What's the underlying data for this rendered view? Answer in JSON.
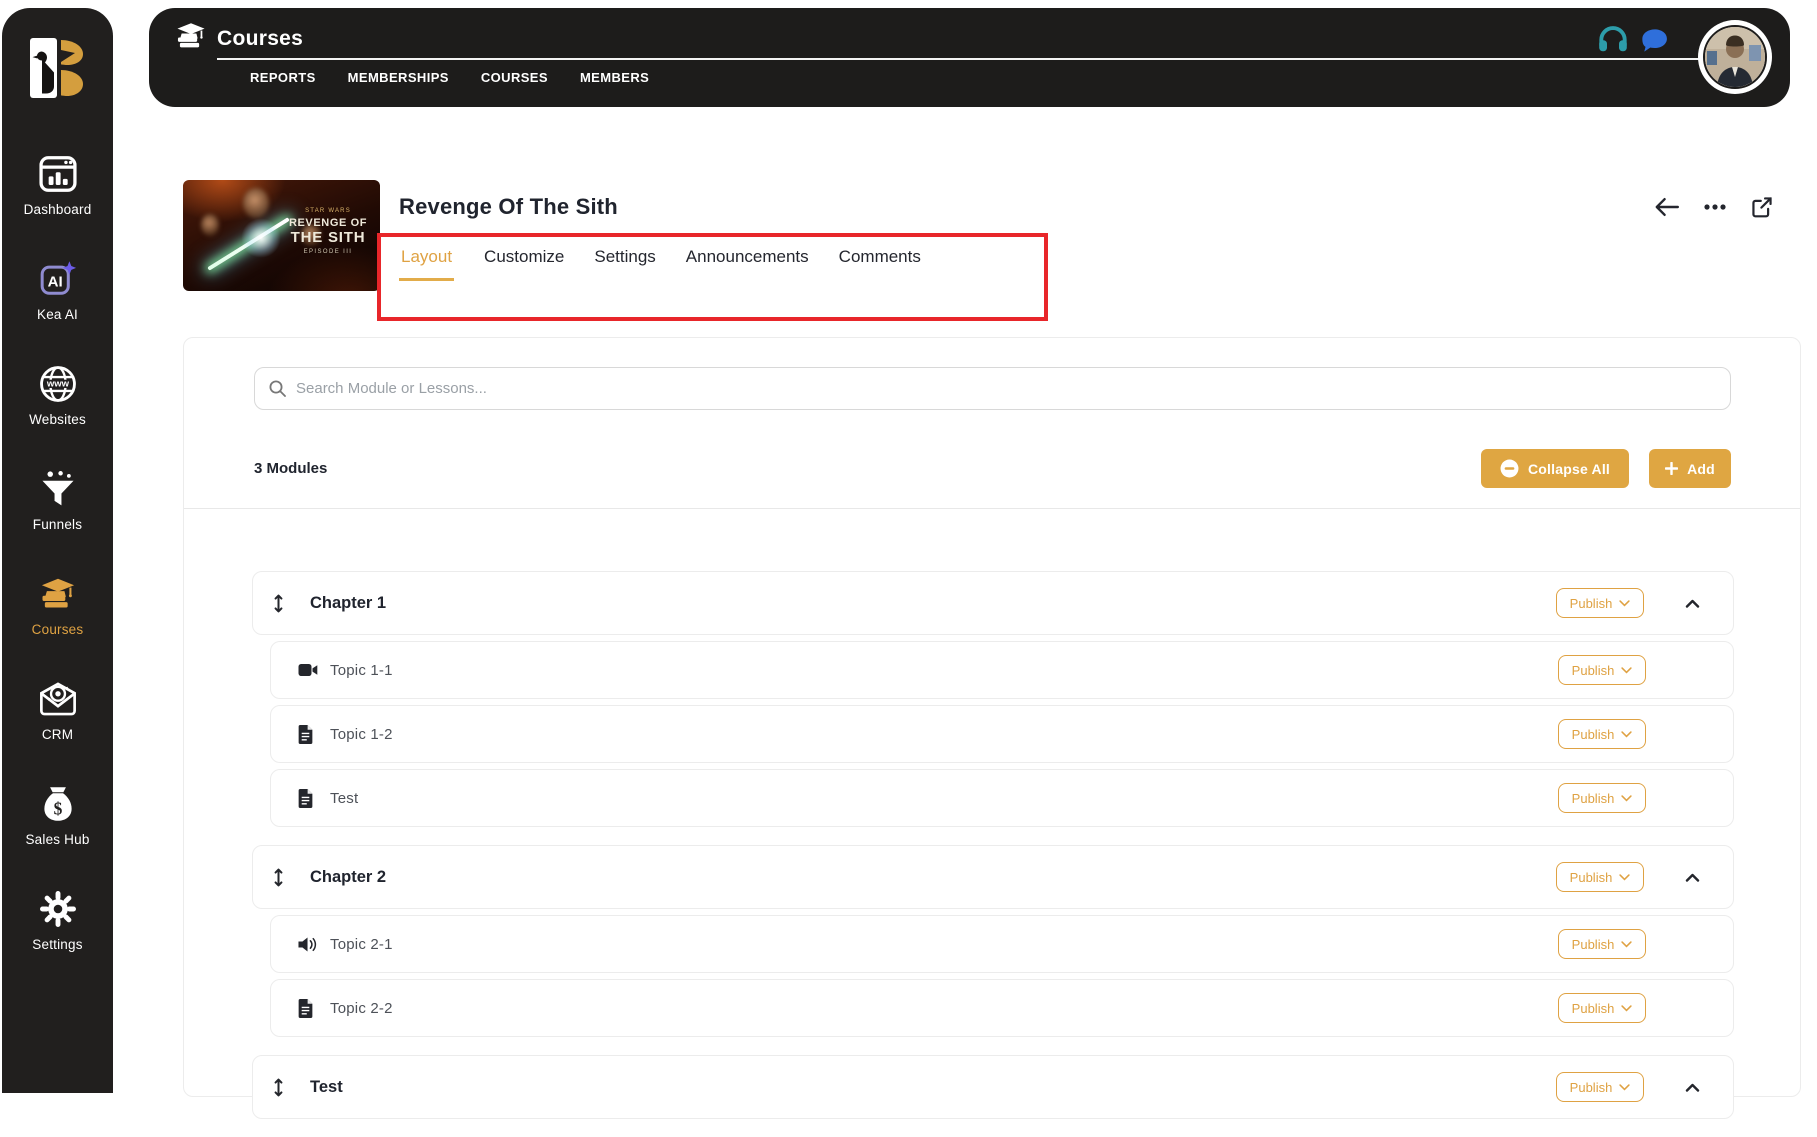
{
  "colors": {
    "accent_gold": "#DFA243",
    "annotation_red": "#E8262A",
    "sidebar_bg": "#211f1e",
    "header_bg": "#1d1c1b",
    "headphones_teal": "#2D9DAA",
    "chat_blue": "#2F6FDB"
  },
  "sidebar": {
    "items": [
      {
        "label": "Dashboard",
        "icon": "dashboard-icon",
        "active": false
      },
      {
        "label": "Kea AI",
        "icon": "kea-ai-icon",
        "active": false
      },
      {
        "label": "Websites",
        "icon": "websites-icon",
        "active": false
      },
      {
        "label": "Funnels",
        "icon": "funnels-icon",
        "active": false
      },
      {
        "label": "Courses",
        "icon": "courses-icon",
        "active": true
      },
      {
        "label": "CRM",
        "icon": "crm-icon",
        "active": false
      },
      {
        "label": "Sales Hub",
        "icon": "sales-hub-icon",
        "active": false
      },
      {
        "label": "Settings",
        "icon": "settings-icon",
        "active": false
      }
    ]
  },
  "header": {
    "app_title": "Courses",
    "nav": [
      {
        "label": "REPORTS"
      },
      {
        "label": "MEMBERSHIPS"
      },
      {
        "label": "COURSES"
      },
      {
        "label": "MEMBERS"
      }
    ]
  },
  "course": {
    "title": "Revenge Of The Sith",
    "poster": {
      "brand": "STAR WARS",
      "line1": "REVENGE OF",
      "line2": "THE SITH",
      "episode": "EPISODE III"
    },
    "tabs": [
      {
        "label": "Layout",
        "active": true
      },
      {
        "label": "Customize",
        "active": false
      },
      {
        "label": "Settings",
        "active": false
      },
      {
        "label": "Announcements",
        "active": false
      },
      {
        "label": "Comments",
        "active": false
      }
    ]
  },
  "toolbar": {
    "search_placeholder": "Search Module or Lessons...",
    "modules_count_label": "3 Modules",
    "collapse_all_label": "Collapse All",
    "add_label": "Add"
  },
  "modules": [
    {
      "title": "Chapter 1",
      "status": "Publish",
      "lessons": [
        {
          "title": "Topic 1-1",
          "type": "video",
          "status": "Publish"
        },
        {
          "title": "Topic 1-2",
          "type": "document",
          "status": "Publish"
        },
        {
          "title": "Test",
          "type": "document",
          "status": "Publish"
        }
      ]
    },
    {
      "title": "Chapter 2",
      "status": "Publish",
      "lessons": [
        {
          "title": "Topic 2-1",
          "type": "audio",
          "status": "Publish"
        },
        {
          "title": "Topic 2-2",
          "type": "document",
          "status": "Publish"
        }
      ]
    },
    {
      "title": "Test",
      "status": "Publish",
      "lessons": []
    }
  ]
}
